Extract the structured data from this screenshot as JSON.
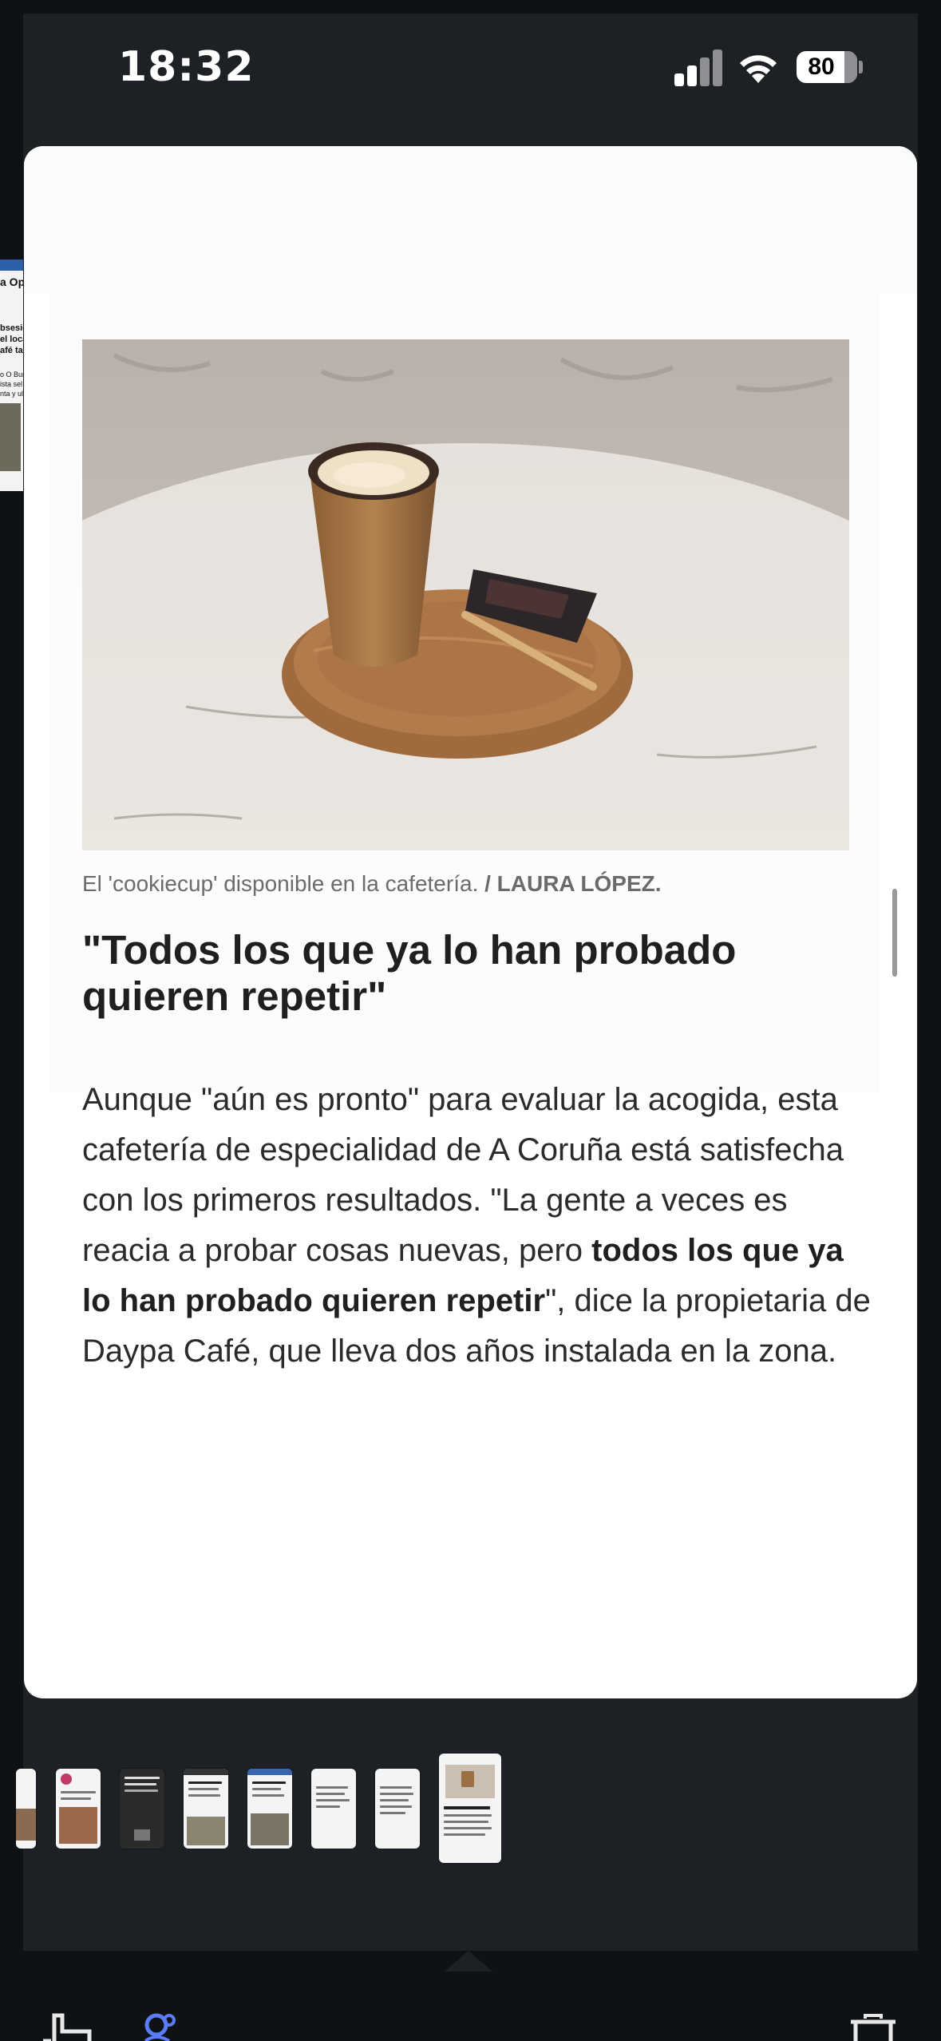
{
  "status_bar": {
    "time": "18:32",
    "battery": "80",
    "signal_icon": "cellular-signal-icon",
    "wifi_icon": "wifi-icon"
  },
  "peek_page": {
    "lines": [
      "a Opi",
      "bsesió",
      "el loca",
      "afé tan",
      "o O Bur",
      "ista sel",
      "nta y ul"
    ]
  },
  "article": {
    "photo_alt": "Coffee cup on wooden tray",
    "caption_text": "El 'cookiecup' disponible en la cafetería. ",
    "caption_credit": "/ LAURA LÓPEZ.",
    "heading": "\"Todos los que ya lo han probado quieren repetir\"",
    "body_1": "Aunque \"aún es pronto\" para evaluar la acogida, esta cafetería de especialidad de A Coruña está satisfecha con los primeros resultados. \"La gente a veces es reacia a probar cosas nuevas, pero ",
    "body_bold": "todos los que ya lo han probado quieren repetir",
    "body_2": "\", dice la propietaria de Daypa Café, que lleva dos años instalada en la zona."
  },
  "thumbnails": {
    "count": 8,
    "selected_index": 8
  },
  "toolbar": {
    "left_icon": "crop-icon",
    "accent_icon": "search-person-icon",
    "right_icon": "trash-icon",
    "accent_color": "#5b7cf7"
  },
  "colors": {
    "background": "#1d2126",
    "card": "#ffffff",
    "text": "#1f1f1f"
  }
}
